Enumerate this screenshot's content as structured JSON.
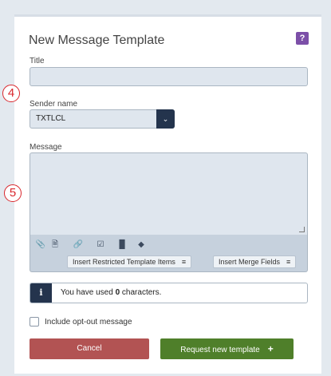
{
  "dialog": {
    "title": "New Message Template",
    "help_icon": "question-icon",
    "help_label": "?"
  },
  "markers": {
    "sender": "4",
    "message": "5"
  },
  "fields": {
    "title_label": "Title",
    "title_value": "",
    "sender_label": "Sender name",
    "sender_value": "TXTLCL",
    "message_label": "Message",
    "message_value": ""
  },
  "toolbar": {
    "icons": [
      "paperclip-icon",
      "document-icon",
      "link-icon",
      "checkbox-icon",
      "barcode-icon",
      "tag-icon"
    ],
    "restricted_button": "Insert Restricted Template Items",
    "merge_button": "Insert Merge Fields"
  },
  "info": {
    "prefix": "You have used ",
    "count": "0",
    "suffix": " characters."
  },
  "optout": {
    "label": "Include opt-out message",
    "checked": false
  },
  "buttons": {
    "cancel": "Cancel",
    "request": "Request new template"
  },
  "colors": {
    "accent_purple": "#7c4fa8",
    "navy": "#24344d",
    "cancel_red": "#b25353",
    "request_green": "#4f7f2a",
    "marker_red": "#d9262c"
  }
}
